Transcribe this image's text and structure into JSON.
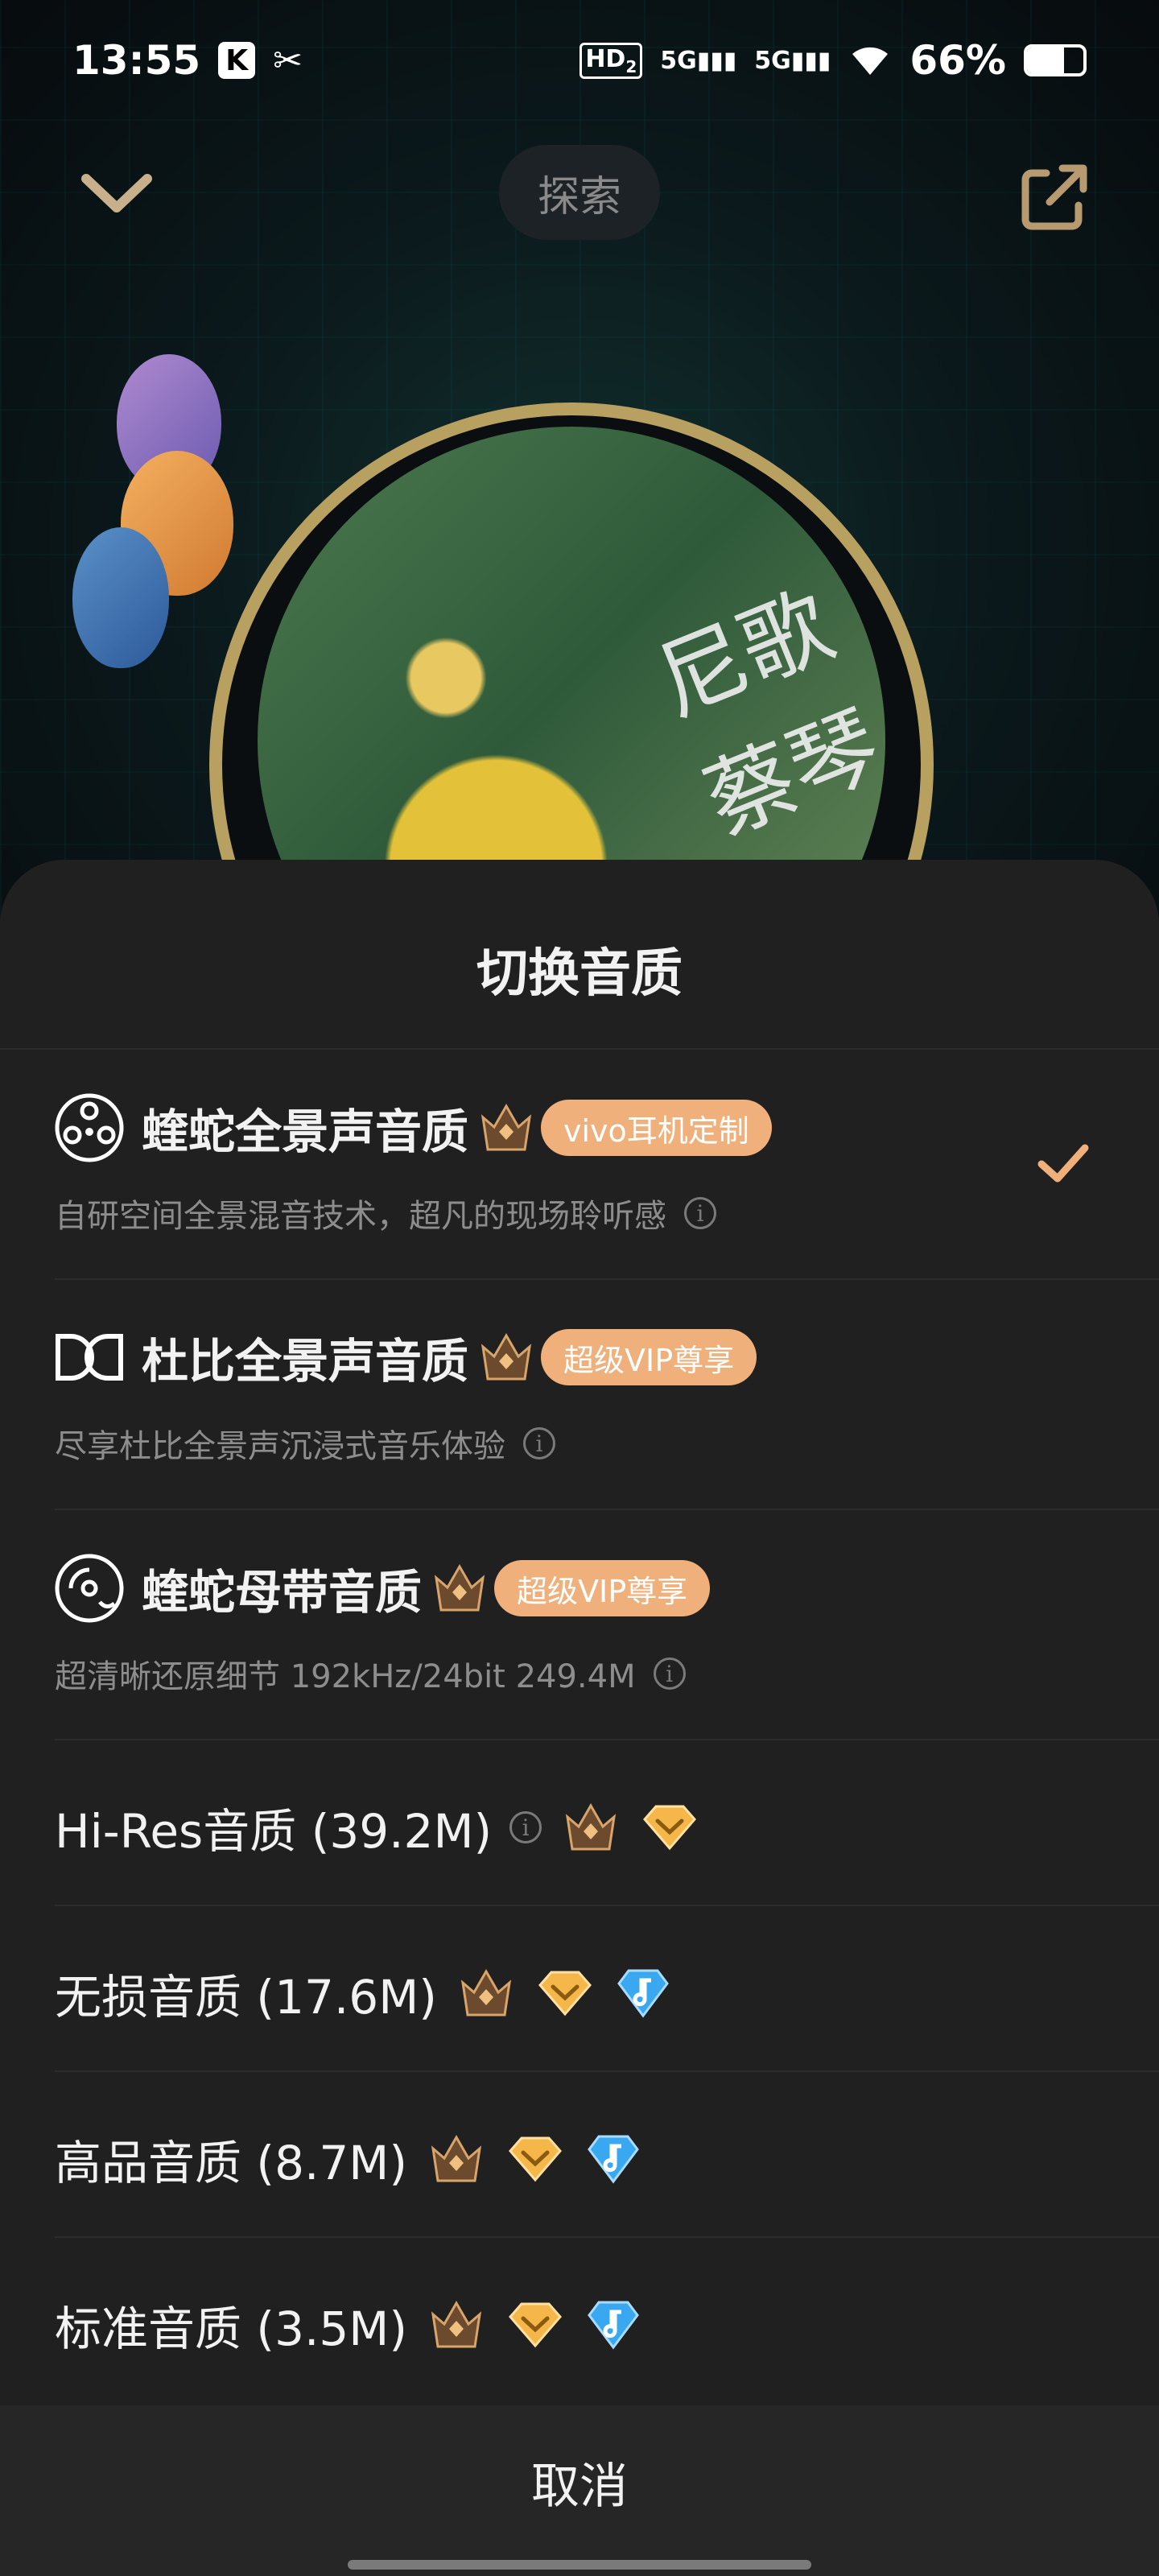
{
  "status_bar": {
    "time": "13:55",
    "app_badge": "K",
    "hd": "HD",
    "hd_sub": "2",
    "signal1": "5G",
    "signal2": "5G",
    "battery": "66%",
    "battery_level": 0.66
  },
  "player": {
    "explore_label": "探索",
    "cover_text": "尼歌 蔡琴"
  },
  "sheet": {
    "title": "切换音质",
    "options": [
      {
        "title": "蝰蛇全景声音质",
        "badge": "vivo耳机定制",
        "subtitle": "自研空间全景混音技术，超凡的现场聆听感",
        "selected": true
      },
      {
        "title": "杜比全景声音质",
        "badge": "超级VIP尊享",
        "subtitle": "尽享杜比全景声沉浸式音乐体验",
        "selected": false
      },
      {
        "title": "蝰蛇母带音质",
        "badge": "超级VIP尊享",
        "subtitle": "超清晰还原细节 192kHz/24bit  249.4M",
        "selected": false
      },
      {
        "title": "Hi-Res音质 (39.2M)",
        "selected": false
      },
      {
        "title": "无损音质 (17.6M)",
        "selected": false
      },
      {
        "title": "高品音质 (8.7M)",
        "selected": false
      },
      {
        "title": "标准音质 (3.5M)",
        "selected": false
      }
    ],
    "cancel_label": "取消"
  },
  "colors": {
    "sheet_bg": "#202020",
    "badge": "#f0b07c",
    "check": "#f0b07c",
    "crown": "#7a5a3a",
    "gem": "#f5b64a",
    "note": "#3aa8f0"
  }
}
